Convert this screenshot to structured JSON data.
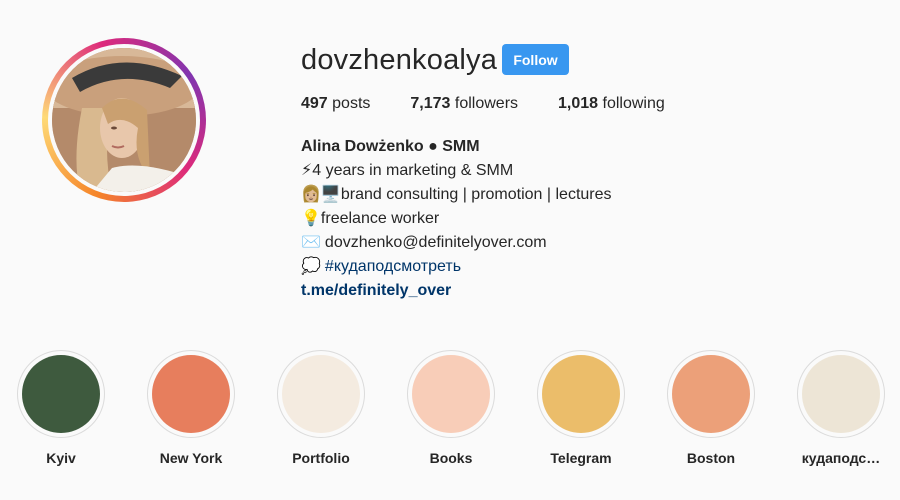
{
  "profile": {
    "username": "dovzhenkoalya",
    "follow_label": "Follow",
    "stats": {
      "posts_count": "497",
      "posts_label": " posts",
      "followers_count": "7,173",
      "followers_label": " followers",
      "following_count": "1,018",
      "following_label": " following"
    },
    "bio": {
      "name": "Alina Dowżenko ● SMM",
      "line1_icon": "⚡",
      "line1": "4 years in marketing & SMM",
      "line2_icons": "👩🏼🖥️",
      "line2": "brand consulting | promotion | lectures",
      "line3_icon": "💡",
      "line3": "freelance worker",
      "line4_icon": "✉️",
      "line4": "dovzhenko@definitelyover.com",
      "line5_icon": "💭",
      "line5": "#кудаподсмотреть",
      "link": "t.me/definitely_over"
    }
  },
  "highlights": [
    {
      "label": "Kyiv",
      "color": "#3e5a3e"
    },
    {
      "label": "New York",
      "color": "#e77e5d"
    },
    {
      "label": "Portfolio",
      "color": "#f4ebe0"
    },
    {
      "label": "Books",
      "color": "#f8cdb8"
    },
    {
      "label": "Telegram",
      "color": "#ebbd6a"
    },
    {
      "label": "Boston",
      "color": "#eca079"
    },
    {
      "label": "кудаподс…",
      "color": "#ede5d6"
    }
  ]
}
